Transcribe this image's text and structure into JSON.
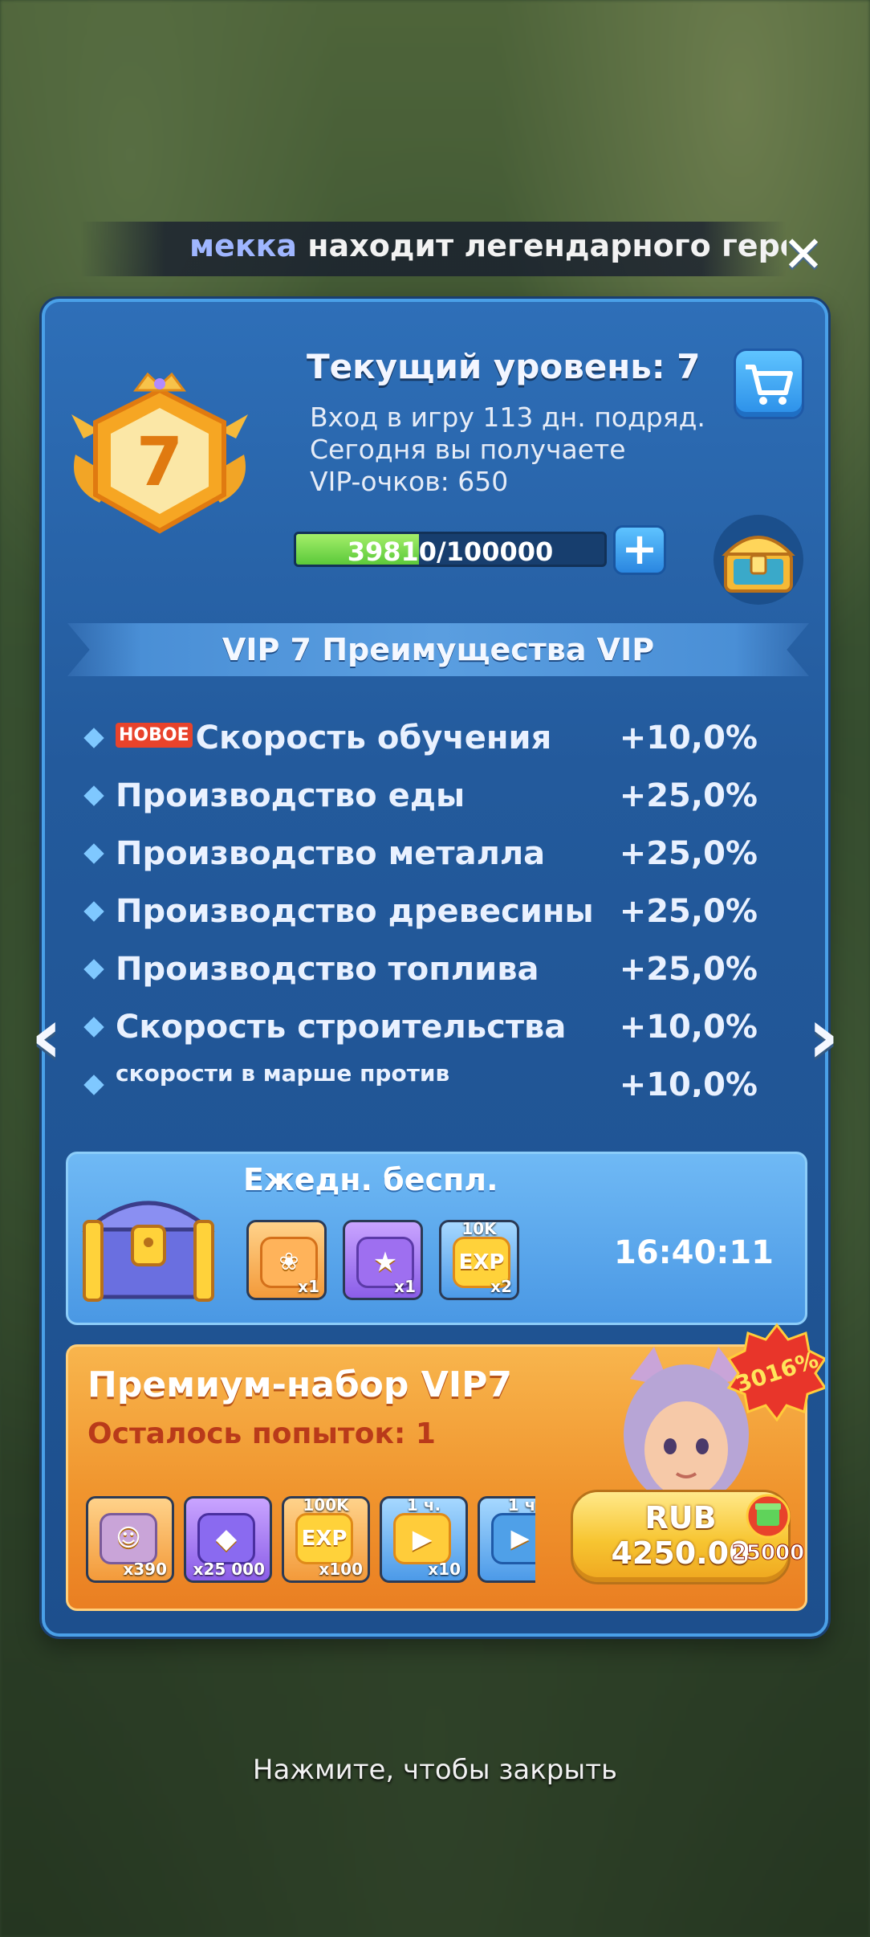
{
  "ticker": {
    "name": "мекка",
    "text": "находит легендарного героя"
  },
  "vip": {
    "level_badge": "7",
    "title": "Текущий уровень: 7",
    "login_days": "Вход в игру 113 дн. подряд.",
    "today_line": "Сегодня вы получаете",
    "points_line": "VIP-очков: 650",
    "progress_current": 39810,
    "progress_max": 100000,
    "progress_text": "39810/100000"
  },
  "section_title": "VIP 7 Преимущества VIP",
  "new_tag": "НОВОЕ",
  "benefits": [
    {
      "name": "Скорость обучения",
      "value": "+10,0%"
    },
    {
      "name": "Производство еды",
      "value": "+25,0%"
    },
    {
      "name": "Производство металла",
      "value": "+25,0%"
    },
    {
      "name": "Производство древесины",
      "value": "+25,0%"
    },
    {
      "name": "Производство топлива",
      "value": "+25,0%"
    },
    {
      "name": "Скорость строительства",
      "value": "+10,0%"
    },
    {
      "name": "скорости в марше против",
      "value": "+10,0%"
    }
  ],
  "daily": {
    "title": "Ежедн. беспл.",
    "timer": "16:40:11",
    "items": [
      {
        "icon": "skill-medal-icon",
        "qty": "x1",
        "top": ""
      },
      {
        "icon": "purple-card-icon",
        "qty": "x1",
        "top": ""
      },
      {
        "icon": "exp-icon",
        "qty": "x2",
        "top": "10K",
        "label": "EXP"
      }
    ]
  },
  "premium": {
    "title": "Премиум-набор VIP7",
    "attempts": "Осталось попыток: 1",
    "discount": "3016%",
    "bonus": "25000",
    "price_currency": "RUB",
    "price_value": "4250.00",
    "items": [
      {
        "icon": "hero-shard-icon",
        "qty": "x390",
        "top": ""
      },
      {
        "icon": "gem-icon",
        "qty": "x25 000",
        "top": ""
      },
      {
        "icon": "exp-icon",
        "qty": "x100",
        "top": "100K",
        "label": "EXP"
      },
      {
        "icon": "hammer-speedup-icon",
        "qty": "x10",
        "top": "1 ч."
      },
      {
        "icon": "speedup-icon",
        "qty": "",
        "top": "1 ч"
      }
    ]
  },
  "tap_to_close": "Нажмите, чтобы закрыть",
  "colors": {
    "panel": "#235a9c",
    "accent_green": "#5bc93a",
    "premium_orange": "#f0952e",
    "price_gold": "#f7c531",
    "new_tag_red": "#e8432b"
  }
}
